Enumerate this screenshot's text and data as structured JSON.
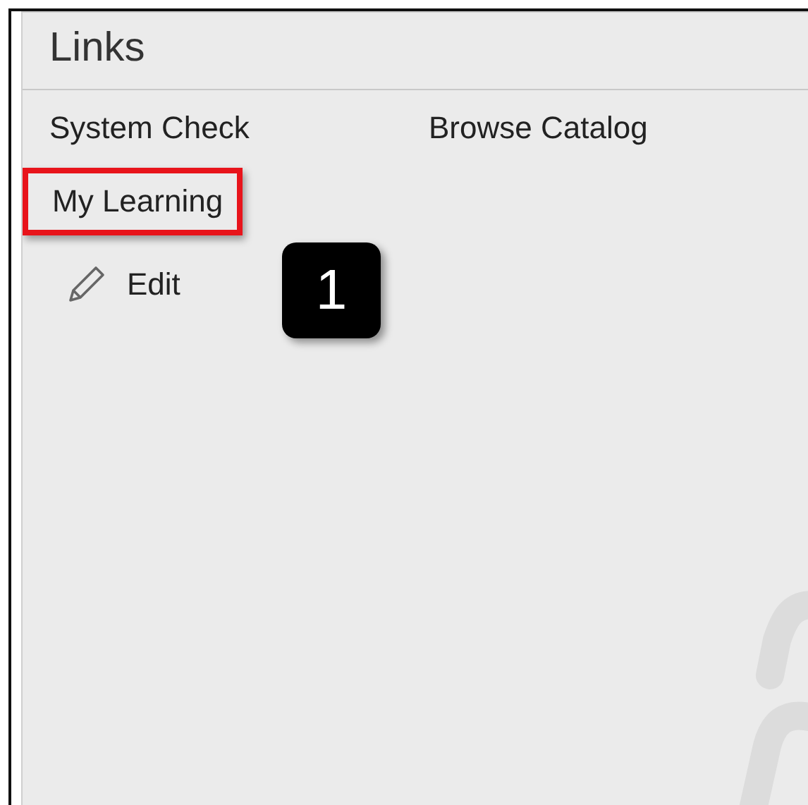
{
  "panel": {
    "title": "Links"
  },
  "links": [
    {
      "label": "System Check",
      "highlighted": false
    },
    {
      "label": "Browse Catalog",
      "highlighted": false
    },
    {
      "label": "My Learning",
      "highlighted": true
    }
  ],
  "edit": {
    "label": "Edit"
  },
  "callout": {
    "label": "1"
  }
}
